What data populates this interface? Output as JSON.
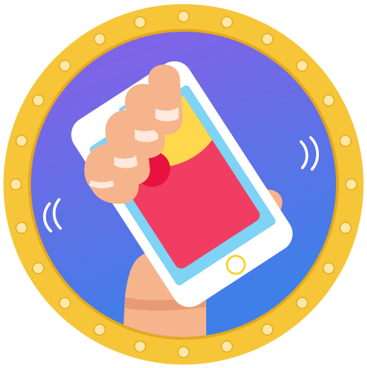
{
  "illustration": {
    "subject": "hand-shaking-phone-with-red-envelope",
    "icons": [
      "hand-icon",
      "phone-icon",
      "red-envelope-icon",
      "shake-motion-icon",
      "bulb-frame-icon"
    ]
  },
  "colors": {
    "frame_gold": "#f6c538",
    "frame_gold_dark": "#e4a81e",
    "bulb": "#fde8a6",
    "bg_top": "#8a5fe6",
    "bg_bottom": "#3e7fe8",
    "phone_body": "#ffffff",
    "phone_screen": "#7fd3f4",
    "envelope_red": "#f23d62",
    "envelope_flap": "#ffd84b",
    "seal": "#e8123f",
    "skin": "#f6b48c",
    "skin_shadow": "#e89b72",
    "nail": "#fde9dd",
    "home_button": "#f6d42a"
  }
}
